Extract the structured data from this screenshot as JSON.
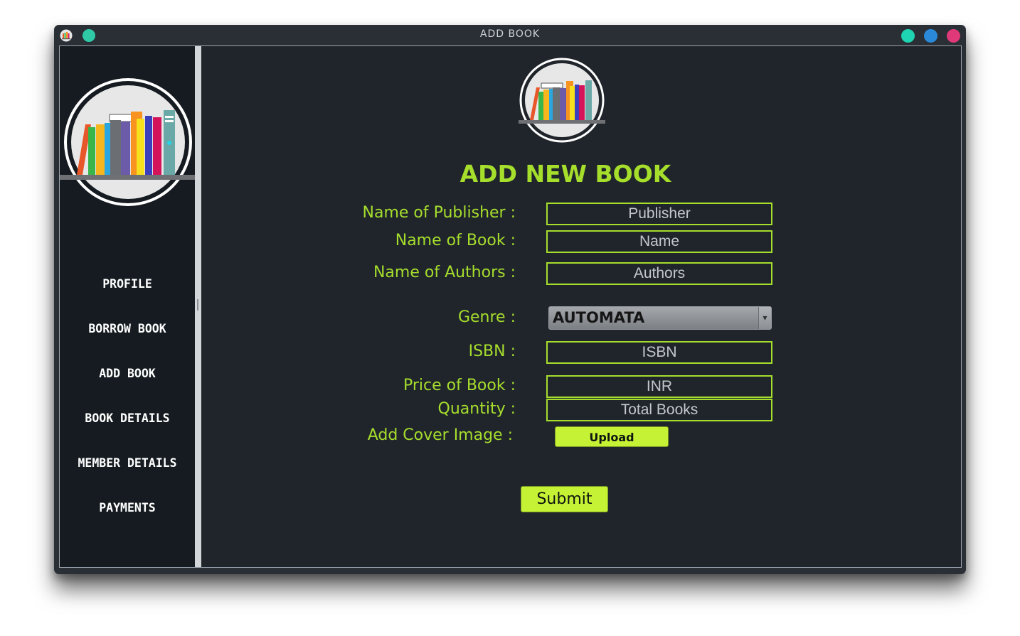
{
  "window": {
    "title": "ADD BOOK"
  },
  "sidebar": {
    "items": [
      {
        "label": "PROFILE"
      },
      {
        "label": "BORROW BOOK"
      },
      {
        "label": "ADD BOOK"
      },
      {
        "label": "BOOK DETAILS"
      },
      {
        "label": "MEMBER DETAILS"
      },
      {
        "label": "PAYMENTS"
      }
    ]
  },
  "form": {
    "heading": "ADD NEW BOOK",
    "publisher": {
      "label": "Name of Publisher :",
      "placeholder": "Publisher"
    },
    "book_name": {
      "label": "Name of Book :",
      "placeholder": "Name"
    },
    "authors": {
      "label": "Name of Authors :",
      "placeholder": "Authors"
    },
    "genre": {
      "label": "Genre :",
      "selected": "AUTOMATA"
    },
    "isbn": {
      "label": "ISBN :",
      "placeholder": "ISBN"
    },
    "price": {
      "label": "Price of Book :",
      "placeholder": "INR"
    },
    "quantity": {
      "label": "Quantity :",
      "placeholder": "Total Books"
    },
    "cover": {
      "label": "Add Cover Image :",
      "button": "Upload"
    },
    "submit": "Submit"
  },
  "colors": {
    "accent": "#a6de2c",
    "button": "#c6f235",
    "background": "#20252b",
    "sidebar": "#151b20"
  }
}
